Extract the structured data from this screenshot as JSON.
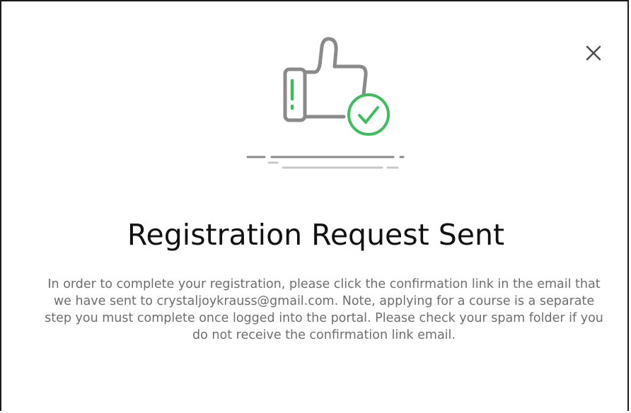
{
  "dialog": {
    "title": "Registration Request Sent",
    "message": "In order to complete your registration, please click the confirmation link in the email that we have sent to crystaljoykrauss@gmail.com. Note, applying for a course is a separate step you must complete once logged into the portal. Please check your spam folder if you do not receive the confirmation link email.",
    "close_icon": "close-icon",
    "illustration_icon": "thumbs-up-check-icon"
  },
  "colors": {
    "accent_green": "#3dbd5d",
    "icon_gray": "#8a8a8a",
    "line_gray": "#c8c8c8",
    "title": "#111111",
    "body_text": "#6e6e6e"
  }
}
